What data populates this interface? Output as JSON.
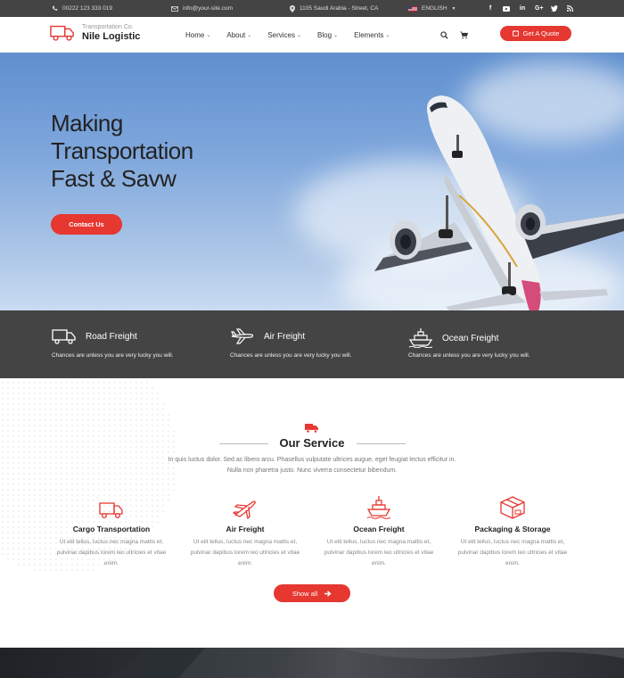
{
  "topbar": {
    "phone": "00222 123 333 019",
    "email": "info@your-site.com",
    "address": "1105 Saudi Arabia - Street, CA",
    "language": "ENGLISH",
    "socials": [
      "f",
      "yt",
      "in",
      "G+",
      "tw",
      "rss"
    ]
  },
  "header": {
    "logo_sub": "Transportation Co.",
    "logo_name": "Nile Logistic",
    "nav": [
      {
        "label": "Home"
      },
      {
        "label": "About"
      },
      {
        "label": "Services"
      },
      {
        "label": "Blog"
      },
      {
        "label": "Elements"
      }
    ],
    "quote_label": "Get A Quote"
  },
  "hero": {
    "title": "Making\nTransportation\nFast & Savw",
    "button_label": "Contact Us"
  },
  "features": [
    {
      "title": "Road Freight",
      "desc": "Chances are unless you are very lucky you will.",
      "icon": "truck-icon"
    },
    {
      "title": "Air Freight",
      "desc": "Chances are unless you are very lucky you will.",
      "icon": "plane-icon"
    },
    {
      "title": "Ocean Freight",
      "desc": "Chances are unless you are very lucky you will.",
      "icon": "ship-icon"
    }
  ],
  "services": {
    "title": "Our Service",
    "desc": "In quis luctus dolor. Sed ac libero arcu. Phasellus vulputate ultrices augue, eget feugiat lectus efficitur in. Nulla non pharetra justo. Nunc viverra consectetur bibendum.",
    "items": [
      {
        "title": "Cargo Transportation",
        "desc": "Ut elit tellus, luctus nec magna mattis et, pulvinar dapibus lorem leo ultricies et vitae enim."
      },
      {
        "title": "Air Freight",
        "desc": "Ut elit tellus, luctus nec magna mattis et, pulvinar dapibus lorem leo ultricies et vitae enim."
      },
      {
        "title": "Ocean Freight",
        "desc": "Ut elit tellus, luctus nec magna mattis et, pulvinar dapibus lorem leo ultricies et vitae enim."
      },
      {
        "title": "Packaging & Storage",
        "desc": "Ut elit tellus, luctus nec magna mattis et, pulvinar dapibus lorem leo ultricies et vitae enim."
      }
    ],
    "show_all_label": "Show all"
  },
  "colors": {
    "accent": "#e63731",
    "dark_strip": "#444444"
  }
}
